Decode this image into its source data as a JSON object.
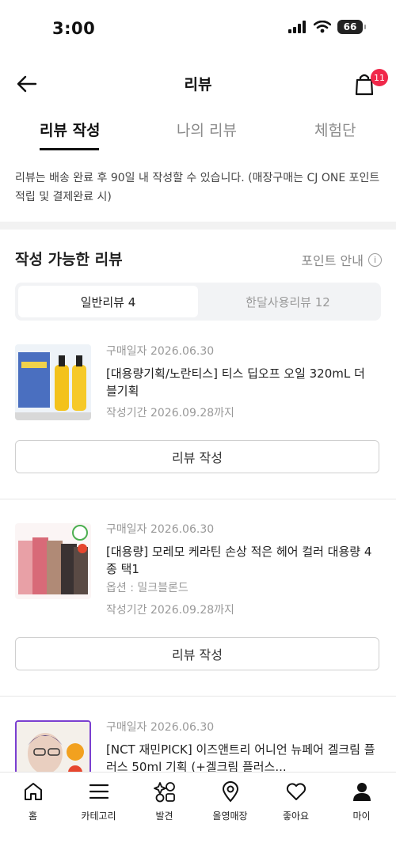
{
  "status": {
    "time": "3:00",
    "battery": "66"
  },
  "header": {
    "title": "리뷰",
    "cart_count": "11"
  },
  "tabs": [
    "리뷰 작성",
    "나의 리뷰",
    "체험단"
  ],
  "notice": "리뷰는 배송 완료 후 90일 내 작성할 수 있습니다. (매장구매는 CJ ONE 포인트 적립 및 결제완료 시)",
  "section": {
    "title": "작성 가능한 리뷰",
    "point_info": "포인트 안내"
  },
  "segments": [
    "일반리뷰 4",
    "한달사용리뷰 12"
  ],
  "products": [
    {
      "purchase_date": "구매일자 2026.06.30",
      "name": "[대용량기획/노란티스] 티스 딥오프 오일 320mL 더블기획",
      "option": "",
      "period": "작성기간 2026.09.28까지",
      "button": "리뷰 작성"
    },
    {
      "purchase_date": "구매일자 2026.06.30",
      "name": "[대용량] 모레모 케라틴 손상 적은 헤어 컬러 대용량 4종 택1",
      "option": "옵션 : 밀크블론드",
      "period": "작성기간 2026.09.28까지",
      "button": "리뷰 작성"
    },
    {
      "purchase_date": "구매일자 2026.06.30",
      "name": "[NCT 재민PICK] 이즈앤트리 어니언 뉴페어 겔크림 플러스 50ml 기획 (+겔크림 플러스...",
      "option": "",
      "period": "",
      "button": ""
    }
  ],
  "bottom_nav": [
    "홈",
    "카테고리",
    "발견",
    "올영매장",
    "좋아요",
    "마이"
  ],
  "colors": {
    "badge": "#f0284a",
    "divider": "#f2f2f2"
  }
}
